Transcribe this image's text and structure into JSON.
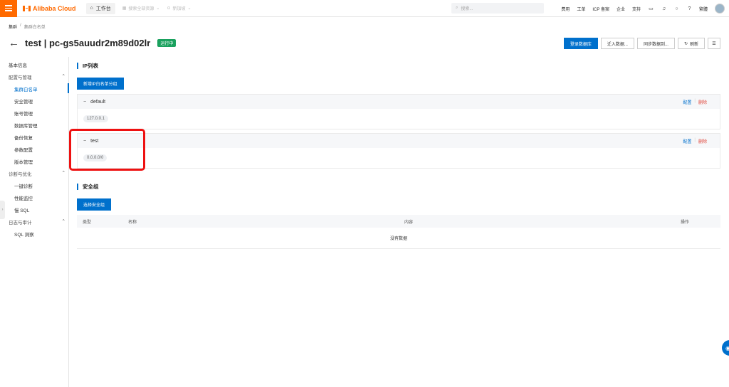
{
  "topbar": {
    "brand": "Alibaba Cloud",
    "workbench": "工作台",
    "nav_account": "搜索全部资源",
    "nav_region": "新加坡",
    "search_placeholder": "搜索...",
    "links": [
      "费用",
      "工单",
      "ICP 备案",
      "企业",
      "支持"
    ],
    "language": "繁體"
  },
  "breadcrumb": {
    "root": "集群",
    "separator": "/",
    "current": "集群白名单"
  },
  "page": {
    "title": "test | pc-gs5auudr2m89d02lr",
    "status": "运行中"
  },
  "actions": {
    "login_db": "登录数据库",
    "migrate_in": "迁入数据...",
    "sync_data": "同步数据到...",
    "refresh": "刷新"
  },
  "sidebar": {
    "basic_info": "基本信息",
    "groups": [
      {
        "label": "配置与管理",
        "items": [
          "集群白名单",
          "安全管理",
          "账号管理",
          "数据库管理",
          "备份恢复",
          "参数配置",
          "版本管理"
        ]
      },
      {
        "label": "诊断与优化",
        "items": [
          "一键诊断",
          "性能监控",
          "慢 SQL"
        ]
      },
      {
        "label": "日志与审计",
        "items": [
          "SQL 洞察"
        ]
      }
    ],
    "active_item": "集群白名单"
  },
  "ip_section": {
    "title": "IP列表",
    "add_button": "新增IP白名单分组",
    "groups": [
      {
        "name": "default",
        "ip": "127.0.0.1",
        "config": "配置",
        "delete": "删除"
      },
      {
        "name": "test",
        "ip": "0.0.0.0/0",
        "config": "配置",
        "delete": "删除"
      }
    ]
  },
  "security_section": {
    "title": "安全组",
    "select_button": "选择安全组",
    "columns": [
      "类型",
      "名称",
      "内容",
      "操作"
    ],
    "empty_text": "没有数据"
  },
  "colors": {
    "accent": "#0070cc",
    "brand": "#ff6a00",
    "status": "#1aa15e",
    "delete": "#e0463a",
    "highlight": "#ee1111"
  }
}
